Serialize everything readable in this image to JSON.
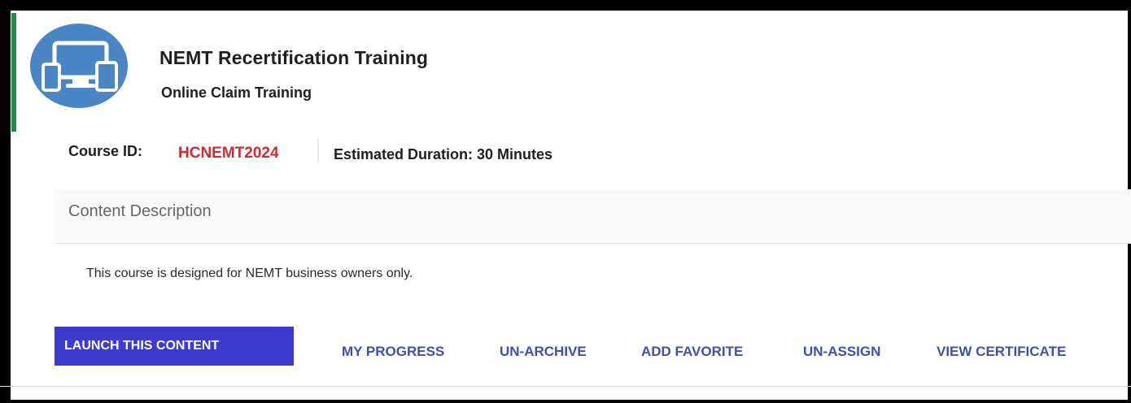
{
  "course": {
    "title": "NEMT Recertification Training",
    "subtitle": "Online Claim Training",
    "icon": "devices-icon",
    "course_id_label": "Course ID:",
    "course_id_value": "HCNEMT2024",
    "duration": "Estimated Duration: 30 Minutes"
  },
  "description": {
    "heading": "Content Description",
    "text": "This course is designed for NEMT business owners only."
  },
  "actions": {
    "launch_label": "LAUNCH THIS CONTENT",
    "links": [
      "MY PROGRESS",
      "UN-ARCHIVE",
      "ADD FAVORITE",
      "UN-ASSIGN",
      "VIEW CERTIFICATE"
    ]
  },
  "colors": {
    "accent": "#1e8a4a",
    "icon_bg": "#4a86c5",
    "course_id": "#d32a2a",
    "primary_button": "#3d3ad0",
    "link": "#3f4fb0"
  }
}
